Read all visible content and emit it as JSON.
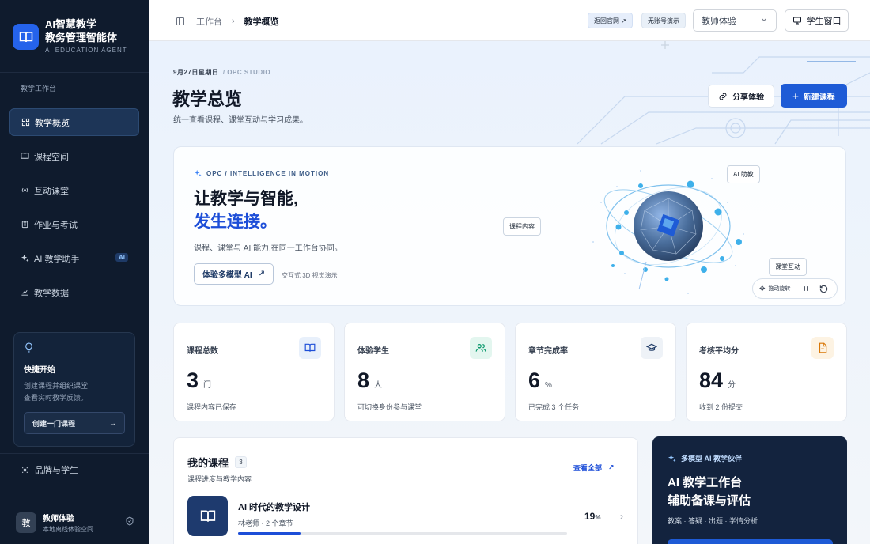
{
  "brand": {
    "title_l1": "AI智慧教学",
    "title_l2": "教务管理智能体",
    "subtitle": "AI EDUCATION AGENT"
  },
  "sidebar": {
    "section_label": "教学工作台",
    "items": [
      {
        "label": "教学概览",
        "icon": "grid-icon",
        "active": true
      },
      {
        "label": "课程空间",
        "icon": "book-icon"
      },
      {
        "label": "互动课堂",
        "icon": "broadcast-icon"
      },
      {
        "label": "作业与考试",
        "icon": "clipboard-icon"
      },
      {
        "label": "AI 教学助手",
        "icon": "sparkle-icon",
        "badge": "AI"
      },
      {
        "label": "教学数据",
        "icon": "chart-icon"
      }
    ],
    "quick_start": {
      "title": "快捷开始",
      "desc_l1": "创建课程并组织课堂",
      "desc_l2": "查看实时教学反馈。",
      "button": "创建一门课程"
    },
    "brand_students": "品牌与学生",
    "user": {
      "avatar": "教",
      "name": "教师体验",
      "sub": "本地离线体验空间"
    }
  },
  "topbar": {
    "breadcrumb_root": "工作台",
    "breadcrumb_sep": "›",
    "breadcrumb_current": "教学概览",
    "back_label": "返回官网 ↗",
    "demo_label": "无账号演示",
    "role_select": "教师体验",
    "student_window": "学生窗口"
  },
  "page": {
    "date": "9月27日星期日",
    "studio": "/ OPC STUDIO",
    "title": "教学总览",
    "subtitle": "统一查看课程、课堂互动与学习成果。",
    "share_button": "分享体验",
    "new_course_button": "新建课程"
  },
  "hero": {
    "kicker": "OPC / INTELLIGENCE IN MOTION",
    "title_l1": "让教学与智能,",
    "title_l2": "发生连接。",
    "desc": "课程、课堂与 AI 能力,在同一工作台协同。",
    "cta": "体验多模型 AI",
    "note": "交互式 3D 视觉演示",
    "tag_ai": "AI 助教",
    "tag_course": "课程内容",
    "tag_class": "课堂互动",
    "rotate_label": "拖动旋转"
  },
  "stats": [
    {
      "label": "课程总数",
      "value": "3",
      "unit": "门",
      "foot": "课程内容已保存",
      "icon": "book-icon",
      "bg": "#e8f0fb",
      "fg": "#1d4ed8"
    },
    {
      "label": "体验学生",
      "value": "8",
      "unit": "人",
      "foot": "可切换身份参与课堂",
      "icon": "users-icon",
      "bg": "#e3f6ef",
      "fg": "#059669"
    },
    {
      "label": "章节完成率",
      "value": "6",
      "unit": "%",
      "foot": "已完成 3 个任务",
      "icon": "graduation-cap-icon",
      "bg": "#eef2f7",
      "fg": "#1e3a66"
    },
    {
      "label": "考核平均分",
      "value": "84",
      "unit": "分",
      "foot": "收到 2 份提交",
      "icon": "document-icon",
      "bg": "#fdf3e3",
      "fg": "#d97706"
    }
  ],
  "courses": {
    "title": "我的课程",
    "count": "3",
    "subtitle": "课程进度与教学内容",
    "see_all": "查看全部",
    "items": [
      {
        "name": "AI 时代的教学设计",
        "meta": "林老师 · 2 个章节",
        "progress": "19",
        "progress_unit": "%",
        "progress_fraction": 0.19
      }
    ]
  },
  "ai_card": {
    "kicker": "多模型 AI 教学伙伴",
    "title_l1": "AI 教学工作台",
    "title_l2": "辅助备课与评估",
    "sub": "教案 · 答疑 · 出题 · 学情分析"
  },
  "colors": {
    "sidebar_bg": "#0f1b2d",
    "accent": "#1e5bd6",
    "ai_card_bg": "#13233e"
  }
}
